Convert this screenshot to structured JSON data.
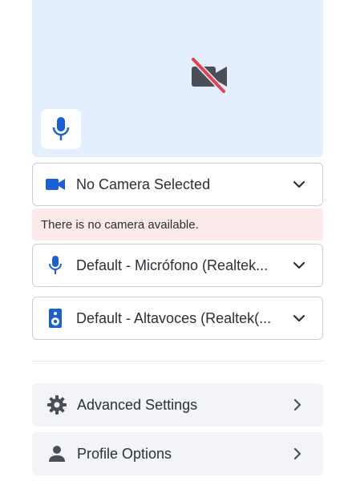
{
  "preview": {
    "camera_icon": "camera-off-icon",
    "mic_icon": "microphone-icon"
  },
  "camera": {
    "selected": "No Camera Selected",
    "icon": "video-camera-icon",
    "error": "There is no camera available."
  },
  "microphone": {
    "selected": "Default - Micrófono (Realtek...",
    "icon": "microphone-icon"
  },
  "speaker": {
    "selected": "Default - Altavoces (Realtek(...",
    "icon": "speaker-icon"
  },
  "menu": {
    "advanced_settings": "Advanced Settings",
    "profile_options": "Profile Options"
  },
  "colors": {
    "accent": "#1a5fd6",
    "preview_bg": "#e3eeff",
    "error_bg": "#fde8ea",
    "camera_off_slash": "#e5414f"
  }
}
